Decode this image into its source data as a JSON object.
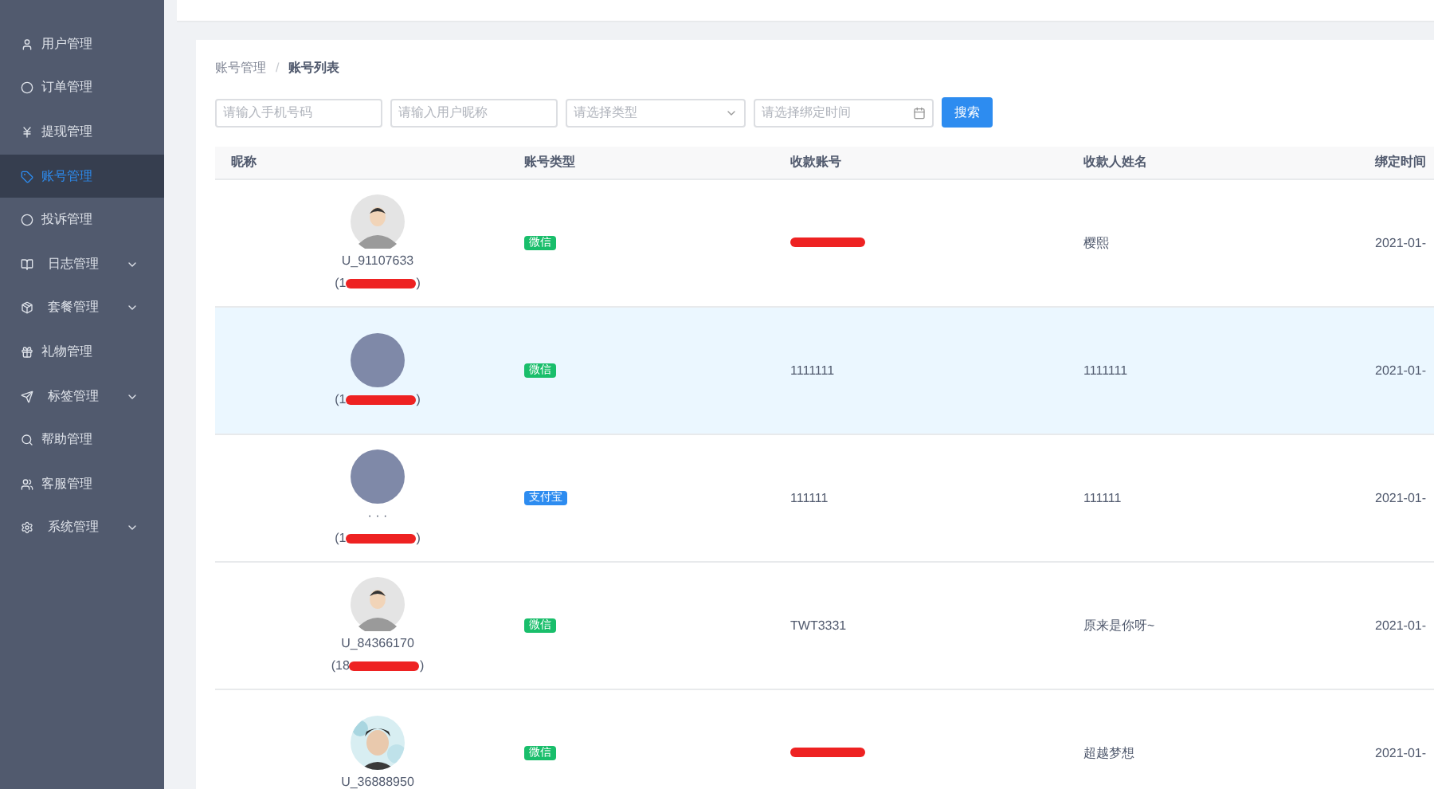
{
  "sidebar": {
    "items": [
      {
        "label": "用户管理",
        "selected": false,
        "expandable": false
      },
      {
        "label": "订单管理",
        "selected": false,
        "expandable": false
      },
      {
        "label": "提现管理",
        "selected": false,
        "expandable": false
      },
      {
        "label": "账号管理",
        "selected": true,
        "expandable": false
      },
      {
        "label": "投诉管理",
        "selected": false,
        "expandable": false
      },
      {
        "label": "日志管理",
        "selected": false,
        "expandable": true
      },
      {
        "label": "套餐管理",
        "selected": false,
        "expandable": true
      },
      {
        "label": "礼物管理",
        "selected": false,
        "expandable": false
      },
      {
        "label": "标签管理",
        "selected": false,
        "expandable": true
      },
      {
        "label": "帮助管理",
        "selected": false,
        "expandable": false
      },
      {
        "label": "客服管理",
        "selected": false,
        "expandable": false
      },
      {
        "label": "系统管理",
        "selected": false,
        "expandable": true
      }
    ]
  },
  "breadcrumb": {
    "items": [
      "账号管理",
      "账号列表"
    ],
    "separator": "/"
  },
  "filters": [
    {
      "kind": "input",
      "placeholder": "请输入手机号码"
    },
    {
      "kind": "input",
      "placeholder": "请输入用户昵称"
    },
    {
      "kind": "select",
      "placeholder": "请选择类型"
    },
    {
      "kind": "date",
      "placeholder": "请选择绑定时间"
    }
  ],
  "search_button": "搜索",
  "table": {
    "columns": [
      "昵称",
      "账号类型",
      "收款账号",
      "收款人姓名",
      "绑定时间"
    ],
    "rows": [
      {
        "avatar": {
          "kind": "default"
        },
        "nickname": "U_91107633",
        "phone_prefix": "(1",
        "phone_suffix": ")",
        "type": {
          "kind": "wechat",
          "label": "微信"
        },
        "account_redacted": true,
        "payee": "樱熙",
        "date": "2021-01-",
        "selected": false
      },
      {
        "avatar": {
          "kind": "blank"
        },
        "phone_prefix": "(1",
        "phone_suffix": ")",
        "type": {
          "kind": "wechat",
          "label": "微信"
        },
        "account": "1111111",
        "account_redacted": false,
        "payee": "1111111",
        "date": "2021-01-",
        "selected": true
      },
      {
        "avatar": {
          "kind": "blank"
        },
        "nickname": "· · ·",
        "phone_prefix": "(1",
        "phone_suffix": ")",
        "type": {
          "kind": "alipay",
          "label": "支付宝"
        },
        "account": "111111",
        "account_redacted": false,
        "payee": "111111",
        "date": "2021-01-",
        "selected": false
      },
      {
        "avatar": {
          "kind": "default"
        },
        "nickname": "U_84366170",
        "phone_prefix": "(18",
        "phone_suffix": ")",
        "type": {
          "kind": "wechat",
          "label": "微信"
        },
        "account": "TWT3331",
        "account_redacted": false,
        "payee": "原来是你呀~",
        "date": "2021-01-",
        "selected": false
      },
      {
        "nickname": "U_36888950",
        "type": {
          "kind": "wechat",
          "label": "微信"
        },
        "account_redacted": true,
        "payee": "超越梦想",
        "date": "2021-01-",
        "selected": false
      }
    ]
  }
}
